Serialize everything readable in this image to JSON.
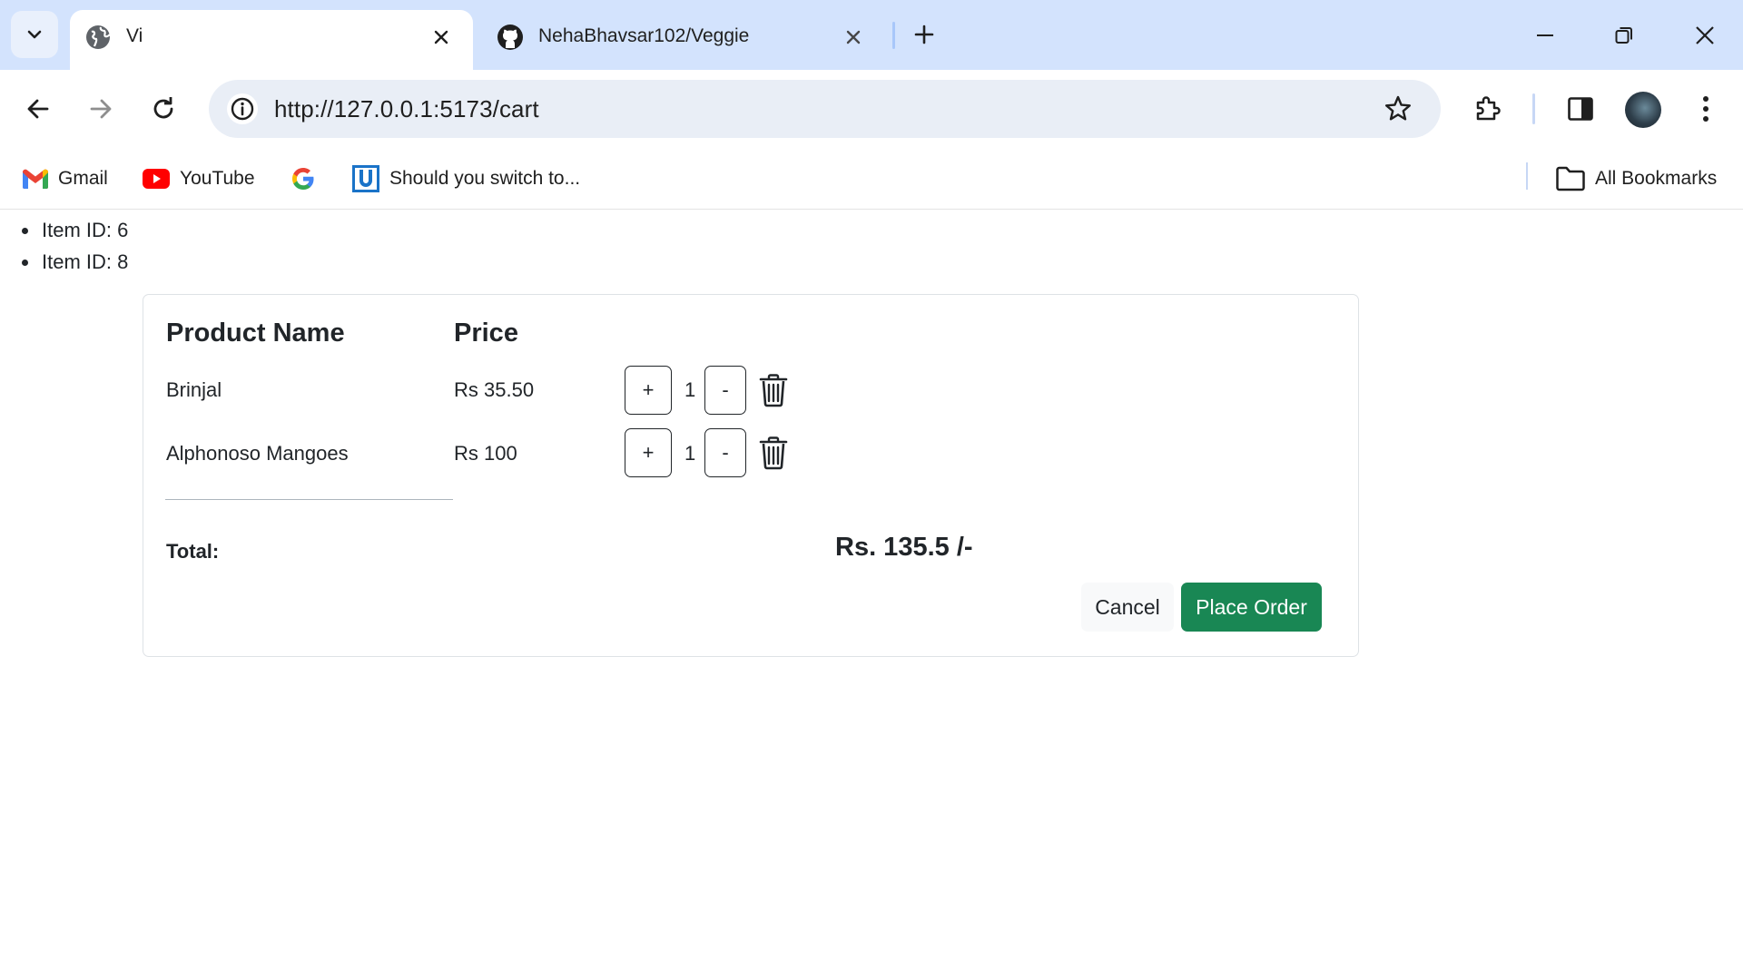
{
  "browser": {
    "tabs": [
      {
        "title": "Vi",
        "active": true,
        "icon": "globe-icon"
      },
      {
        "title": "NehaBhavsar102/Veggie",
        "active": false,
        "icon": "github-icon"
      }
    ],
    "url": "http://127.0.0.1:5173/cart",
    "bookmarks": [
      {
        "label": "Gmail",
        "icon": "gmail-icon"
      },
      {
        "label": "YouTube",
        "icon": "youtube-icon"
      },
      {
        "label": "",
        "icon": "google-icon"
      },
      {
        "label": "Should you switch to...",
        "icon": "u-logo-icon"
      }
    ],
    "all_bookmarks_label": "All Bookmarks"
  },
  "page": {
    "item_ids": [
      "Item ID: 6",
      "Item ID: 8"
    ],
    "cart": {
      "headers": {
        "product": "Product Name",
        "price": "Price"
      },
      "rows": [
        {
          "name": "Brinjal",
          "price": "Rs 35.50",
          "qty": "1",
          "plus": "+",
          "minus": "-"
        },
        {
          "name": "Alphonoso Mangoes",
          "price": "Rs 100",
          "qty": "1",
          "plus": "+",
          "minus": "-"
        }
      ],
      "total_label": "Total:",
      "total_value": "Rs. 135.5 /-",
      "cancel_label": "Cancel",
      "place_order_label": "Place Order"
    }
  },
  "colors": {
    "tabstrip": "#d3e3fd",
    "place_order": "#198754",
    "cancel_bg": "#f8f9fa"
  }
}
